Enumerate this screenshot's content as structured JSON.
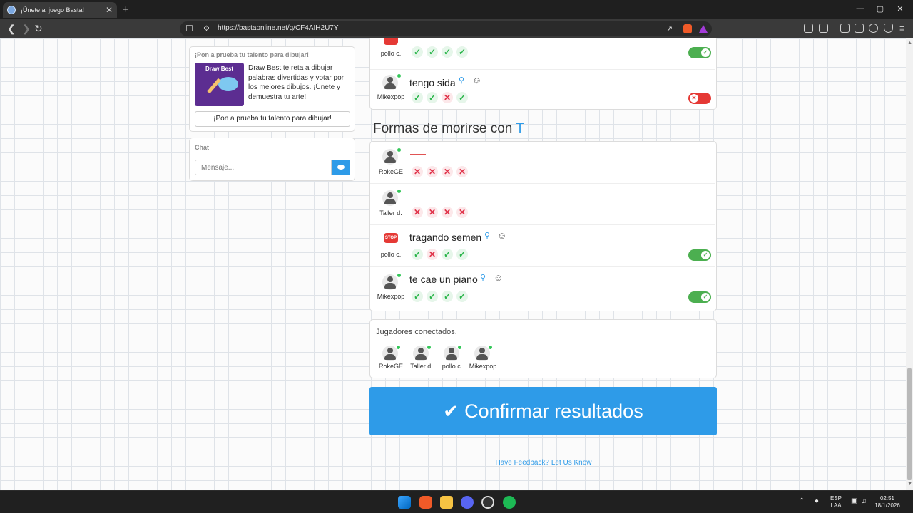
{
  "browser": {
    "tab_title": "¡Únete al juego Basta!",
    "tab_close": "✕",
    "new_tab": "+",
    "url": "https://bastaonline.net/g/CF4AIH2U7Y",
    "controls": {
      "minimize": "—",
      "maximize": "▢",
      "close": "✕"
    }
  },
  "promo": {
    "heading": "¡Pon a prueba tu talento para dibujar!",
    "image_title": "Draw Best",
    "description": "Draw Best te reta a dibujar palabras divertidas y votar por los mejores dibujos. ¡Únete y demuestra tu arte!",
    "button": "¡Pon a prueba tu talento para dibujar!"
  },
  "chat": {
    "heading": "Chat",
    "placeholder": "Mensaje...."
  },
  "previous_category": {
    "rows": [
      {
        "player": "pollo c.",
        "answer": "",
        "votes": [
          "ok",
          "ok",
          "ok",
          "ok"
        ],
        "accepted": true
      },
      {
        "player": "Mikexpop",
        "answer": "tengo sida",
        "votes": [
          "ok",
          "ok",
          "no",
          "ok"
        ],
        "accepted": false
      }
    ]
  },
  "category": {
    "title": "Formas de morirse con",
    "letter": "T",
    "rows": [
      {
        "player": "RokeGE",
        "answer": "",
        "votes": [
          "no",
          "no",
          "no",
          "no"
        ]
      },
      {
        "player": "Taller d.",
        "answer": "",
        "votes": [
          "no",
          "no",
          "no",
          "no"
        ]
      },
      {
        "player": "pollo c.",
        "answer": "tragando semen",
        "votes": [
          "ok",
          "no",
          "ok",
          "ok"
        ],
        "accepted": true
      },
      {
        "player": "Mikexpop",
        "answer": "te cae un piano",
        "votes": [
          "ok",
          "ok",
          "ok",
          "ok"
        ],
        "accepted": true
      }
    ]
  },
  "connected": {
    "title": "Jugadores conectados.",
    "players": [
      "RokeGE",
      "Taller d.",
      "pollo c.",
      "Mikexpop"
    ]
  },
  "confirm_button": "Confirmar resultados",
  "feedback_link": "Have Feedback? Let Us Know",
  "taskbar": {
    "lang_top": "ESP",
    "lang_bottom": "LAA",
    "time": "02:51",
    "date": "18/1/2026"
  },
  "colors": {
    "accent": "#2e9be8",
    "ok": "#2bb54b",
    "no": "#e0334a",
    "toggle_on": "#4caf50",
    "toggle_off": "#e53935"
  }
}
